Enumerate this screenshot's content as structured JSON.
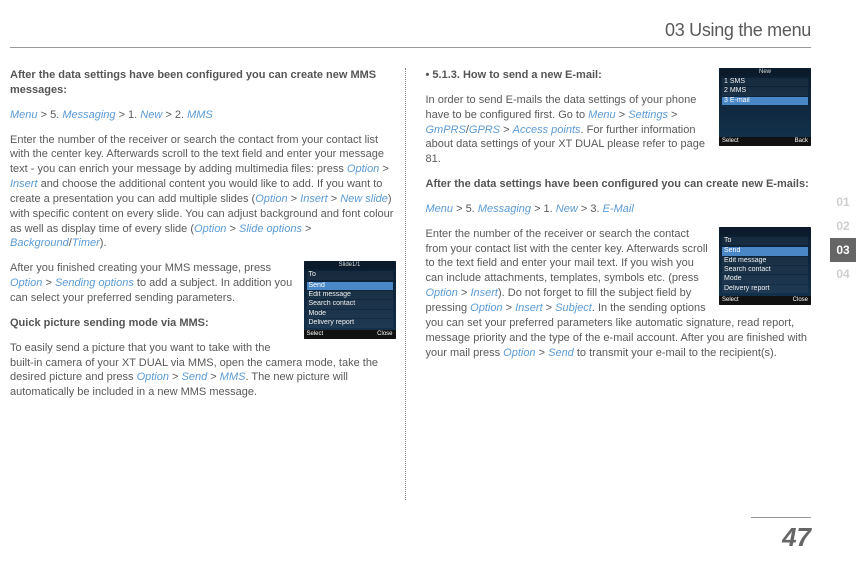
{
  "header": "03 Using the menu",
  "col1": {
    "p1_bold": "After the data settings have been configured you can create new MMS messages:",
    "p2": {
      "m": "Menu",
      "gt1": " > 5. ",
      "msg": "Messaging",
      "gt2": " > 1. ",
      "nw": "New",
      "gt3": " > 2. ",
      "mms": "MMS"
    },
    "p3a": "Enter the number of the receiver or search the contact from your contact list  with the center key. Afterwards scroll to the text field and enter your message text - you can enrich your message by adding multimedia files: press ",
    "opt": "Option",
    "gt": " > ",
    "ins": "Insert",
    "p3b": " and choose the additional content you would like to add. If you want to create a presentation you can add multiple slides (",
    "ns": "New slide",
    "p3c": ") with specific content on every slide. You can adjust background and font colour as well as display time of every slide (",
    "so": "Slide options",
    "bg": "Background",
    "slash": "/",
    "tm": "Timer",
    "p3d": ").",
    "p4a": "After you finished creating your MMS message, press ",
    "sendopt": "Sending options",
    "p4b": " to add a subject. In addition you can select your preferred sending parameters.",
    "p5_bold": "Quick picture sending mode via MMS:",
    "p6a": "To easily send a picture that you want to take with the built-in camera of your XT DUAL via MMS, open the camera mode, take the desired picture and press ",
    "snd": "Send",
    "mms2": "MMS",
    "p6b": ". The new picture will automatically be included in a new MMS message.",
    "ss1": {
      "top": "Slide1/1",
      "rows": [
        "To",
        "",
        "Send",
        "Edit message",
        "Search contact",
        "Mode",
        "Delivery report"
      ],
      "botL": "Select",
      "botR": "Close"
    }
  },
  "col2": {
    "p1_bold": "• 5.1.3. How to send a new E-mail:",
    "p2a": "In order to send E-mails the data settings of your phone have to be configured first. Go to ",
    "m": "Menu",
    "gt": " > ",
    "set": "Settings",
    "gm": "GmPRS",
    "slash": "/",
    "gp": "GPRS",
    "ap": "Access points",
    "p2b": ". For further information about data settings of your XT DUAL please refer to page 81.",
    "p3_bold": "After the data settings have been configured you can create new E-mails:",
    "p4": {
      "m": "Menu",
      "gt1": " > 5. ",
      "msg": "Messaging",
      "gt2": " > 1. ",
      "nw": "New",
      "gt3": " > 3. ",
      "em": "E-Mail"
    },
    "p5a": "Enter the number of the receiver or search the contact from your contact list  with the center key. Afterwards scroll to the text field and enter your mail text. If you wish you can include attachments, templates, symbols etc. (press ",
    "opt": "Option",
    "ins": "Insert",
    "p5b": "). Do not forget to fill the subject field by pressing ",
    "subj": "Subject",
    "p5c": ". In the sending options you can set your preferred parameters like automatic signature, read report, message priority and the type of the e-mail account. After you are finished with your mail press ",
    "snd": "Send",
    "p5d": " to transmit your e-mail to the recipient(s).",
    "ss2": {
      "top": "New",
      "rows": [
        "1 SMS",
        "2 MMS",
        "3 E-mail"
      ],
      "botL": "Select",
      "botR": "Back"
    },
    "ss3": {
      "top": "",
      "rows": [
        "To",
        "",
        "Send",
        "Edit message",
        "Search contact",
        "Mode",
        "Delivery report"
      ],
      "botL": "Select",
      "botR": "Close"
    }
  },
  "tabs": [
    "01",
    "02",
    "03",
    "04"
  ],
  "pageno": "47"
}
